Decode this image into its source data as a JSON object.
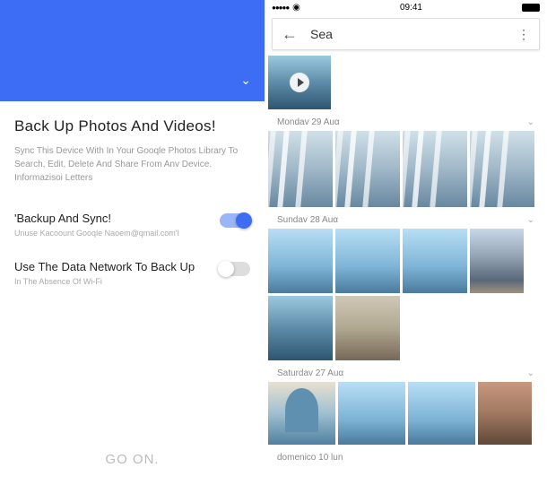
{
  "left": {
    "title": "Back Up Photos And Videos!",
    "subtitle": "Sync This Device With In Your Gooqle Photos Library To Search, Edit, Delete And Share From Anv Device. Informazisoi Letters",
    "backup_sync": {
      "label": "'Backup And Sync!",
      "sub": "Unuse Kacoount Gooqle Naoem@qmail.com'I",
      "enabled": true
    },
    "data_network": {
      "label": "Use The Data Network To Back Up",
      "sub": "In The Absence Of Wi-Fi",
      "enabled": false
    },
    "go_on": "GO ON."
  },
  "right": {
    "status": {
      "time": "09:41"
    },
    "search": {
      "query": "Sea"
    },
    "dates": {
      "mon": "Mondav 29 Auα",
      "sun": "Sundav 28 Auα",
      "sat": "Saturdav 27 Auα",
      "dom": "domenico 10 lun"
    }
  }
}
